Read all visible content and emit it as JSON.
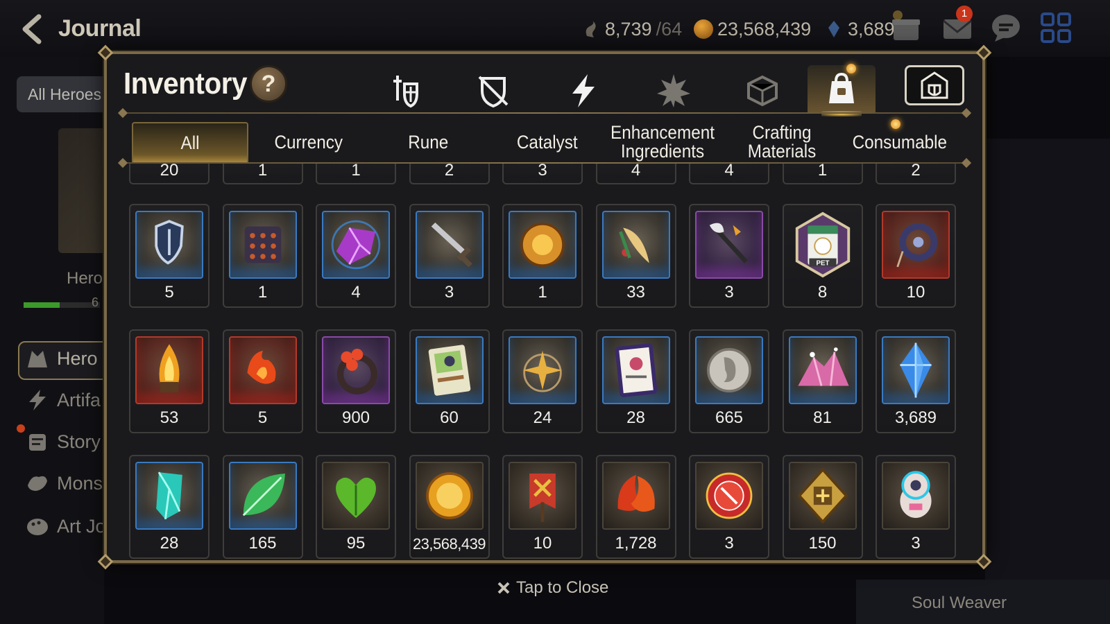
{
  "header": {
    "title": "Journal",
    "stamina": "8,739",
    "stamina_max": "/64",
    "gold": "23,568,439",
    "crystals": "3,689",
    "mail_badge": "1"
  },
  "sidebar": {
    "filter": "All Heroes",
    "hero_label": "Hero",
    "hero_count": "6",
    "items": [
      {
        "label": "Hero"
      },
      {
        "label": "Artifa"
      },
      {
        "label": "Story"
      },
      {
        "label": "Mons"
      },
      {
        "label": "Art Jo"
      }
    ]
  },
  "right_panel": {
    "label": "Soul Weaver"
  },
  "modal": {
    "title": "Inventory",
    "help": "?",
    "close_hint": "Tap to Close",
    "category_icons": [
      "equipment-icon",
      "no-gear-icon",
      "lightning-icon",
      "artifact-icon",
      "cube-icon",
      "bag-icon",
      "shop-icon"
    ],
    "active_category_index": 5,
    "sub_tabs": [
      {
        "label": "All"
      },
      {
        "label": "Currency"
      },
      {
        "label": "Rune"
      },
      {
        "label": "Catalyst"
      },
      {
        "label": "Enhancement Ingredients"
      },
      {
        "label": "Crafting Materials"
      },
      {
        "label": "Consumable"
      }
    ],
    "active_sub_tab": 0
  },
  "inventory": {
    "partial_row": [
      "20",
      "1",
      "1",
      "2",
      "3",
      "4",
      "4",
      "1",
      "2"
    ],
    "rows": [
      [
        {
          "icon": "shield-icon",
          "qty": "5",
          "frame": "blue"
        },
        {
          "icon": "scale-armor-icon",
          "qty": "1",
          "frame": "blue"
        },
        {
          "icon": "crystal-gem-icon",
          "qty": "4",
          "frame": "blue"
        },
        {
          "icon": "sword-icon",
          "qty": "3",
          "frame": "blue"
        },
        {
          "icon": "sun-medallion-icon",
          "qty": "1",
          "frame": "blue"
        },
        {
          "icon": "feather-charm-icon",
          "qty": "33",
          "frame": "blue"
        },
        {
          "icon": "staff-icon",
          "qty": "3",
          "frame": "purple"
        },
        {
          "icon": "pet-snack-icon",
          "qty": "8",
          "frame": "pet"
        },
        {
          "icon": "amulet-icon",
          "qty": "10",
          "frame": "red"
        }
      ],
      [
        {
          "icon": "flame-crystal-icon",
          "qty": "53",
          "frame": "red"
        },
        {
          "icon": "fire-amulet-icon",
          "qty": "5",
          "frame": "red"
        },
        {
          "icon": "flower-ring-icon",
          "qty": "900",
          "frame": "purple"
        },
        {
          "icon": "recipe-card-icon",
          "qty": "60",
          "frame": "blue"
        },
        {
          "icon": "star-pendant-icon",
          "qty": "24",
          "frame": "blue"
        },
        {
          "icon": "certificate-icon",
          "qty": "28",
          "frame": "blue"
        },
        {
          "icon": "silver-coin-icon",
          "qty": "665",
          "frame": "blue"
        },
        {
          "icon": "pink-crystal-icon",
          "qty": "81",
          "frame": "blue"
        },
        {
          "icon": "blue-gem-icon",
          "qty": "3,689",
          "frame": "blue"
        }
      ],
      [
        {
          "icon": "cyan-crystal-icon",
          "qty": "28",
          "frame": "blue"
        },
        {
          "icon": "leaf-icon",
          "qty": "165",
          "frame": "blue"
        },
        {
          "icon": "heart-leaf-icon",
          "qty": "95",
          "frame": "plain"
        },
        {
          "icon": "gold-coin-icon",
          "qty": "23,568,439",
          "frame": "plain"
        },
        {
          "icon": "banner-icon",
          "qty": "10",
          "frame": "plain"
        },
        {
          "icon": "red-leaves-icon",
          "qty": "1,728",
          "frame": "plain"
        },
        {
          "icon": "red-seal-icon",
          "qty": "3",
          "frame": "plain"
        },
        {
          "icon": "gold-emblem-icon",
          "qty": "150",
          "frame": "plain"
        },
        {
          "icon": "robot-pet-icon",
          "qty": "3",
          "frame": "plain"
        }
      ]
    ]
  },
  "colors": {
    "modal_border": "#7b6a48",
    "active_tab": "#6b5628",
    "blue_frame": "#3a7ac0",
    "red_frame": "#b23a2a",
    "purple_frame": "#8a4aa8"
  }
}
